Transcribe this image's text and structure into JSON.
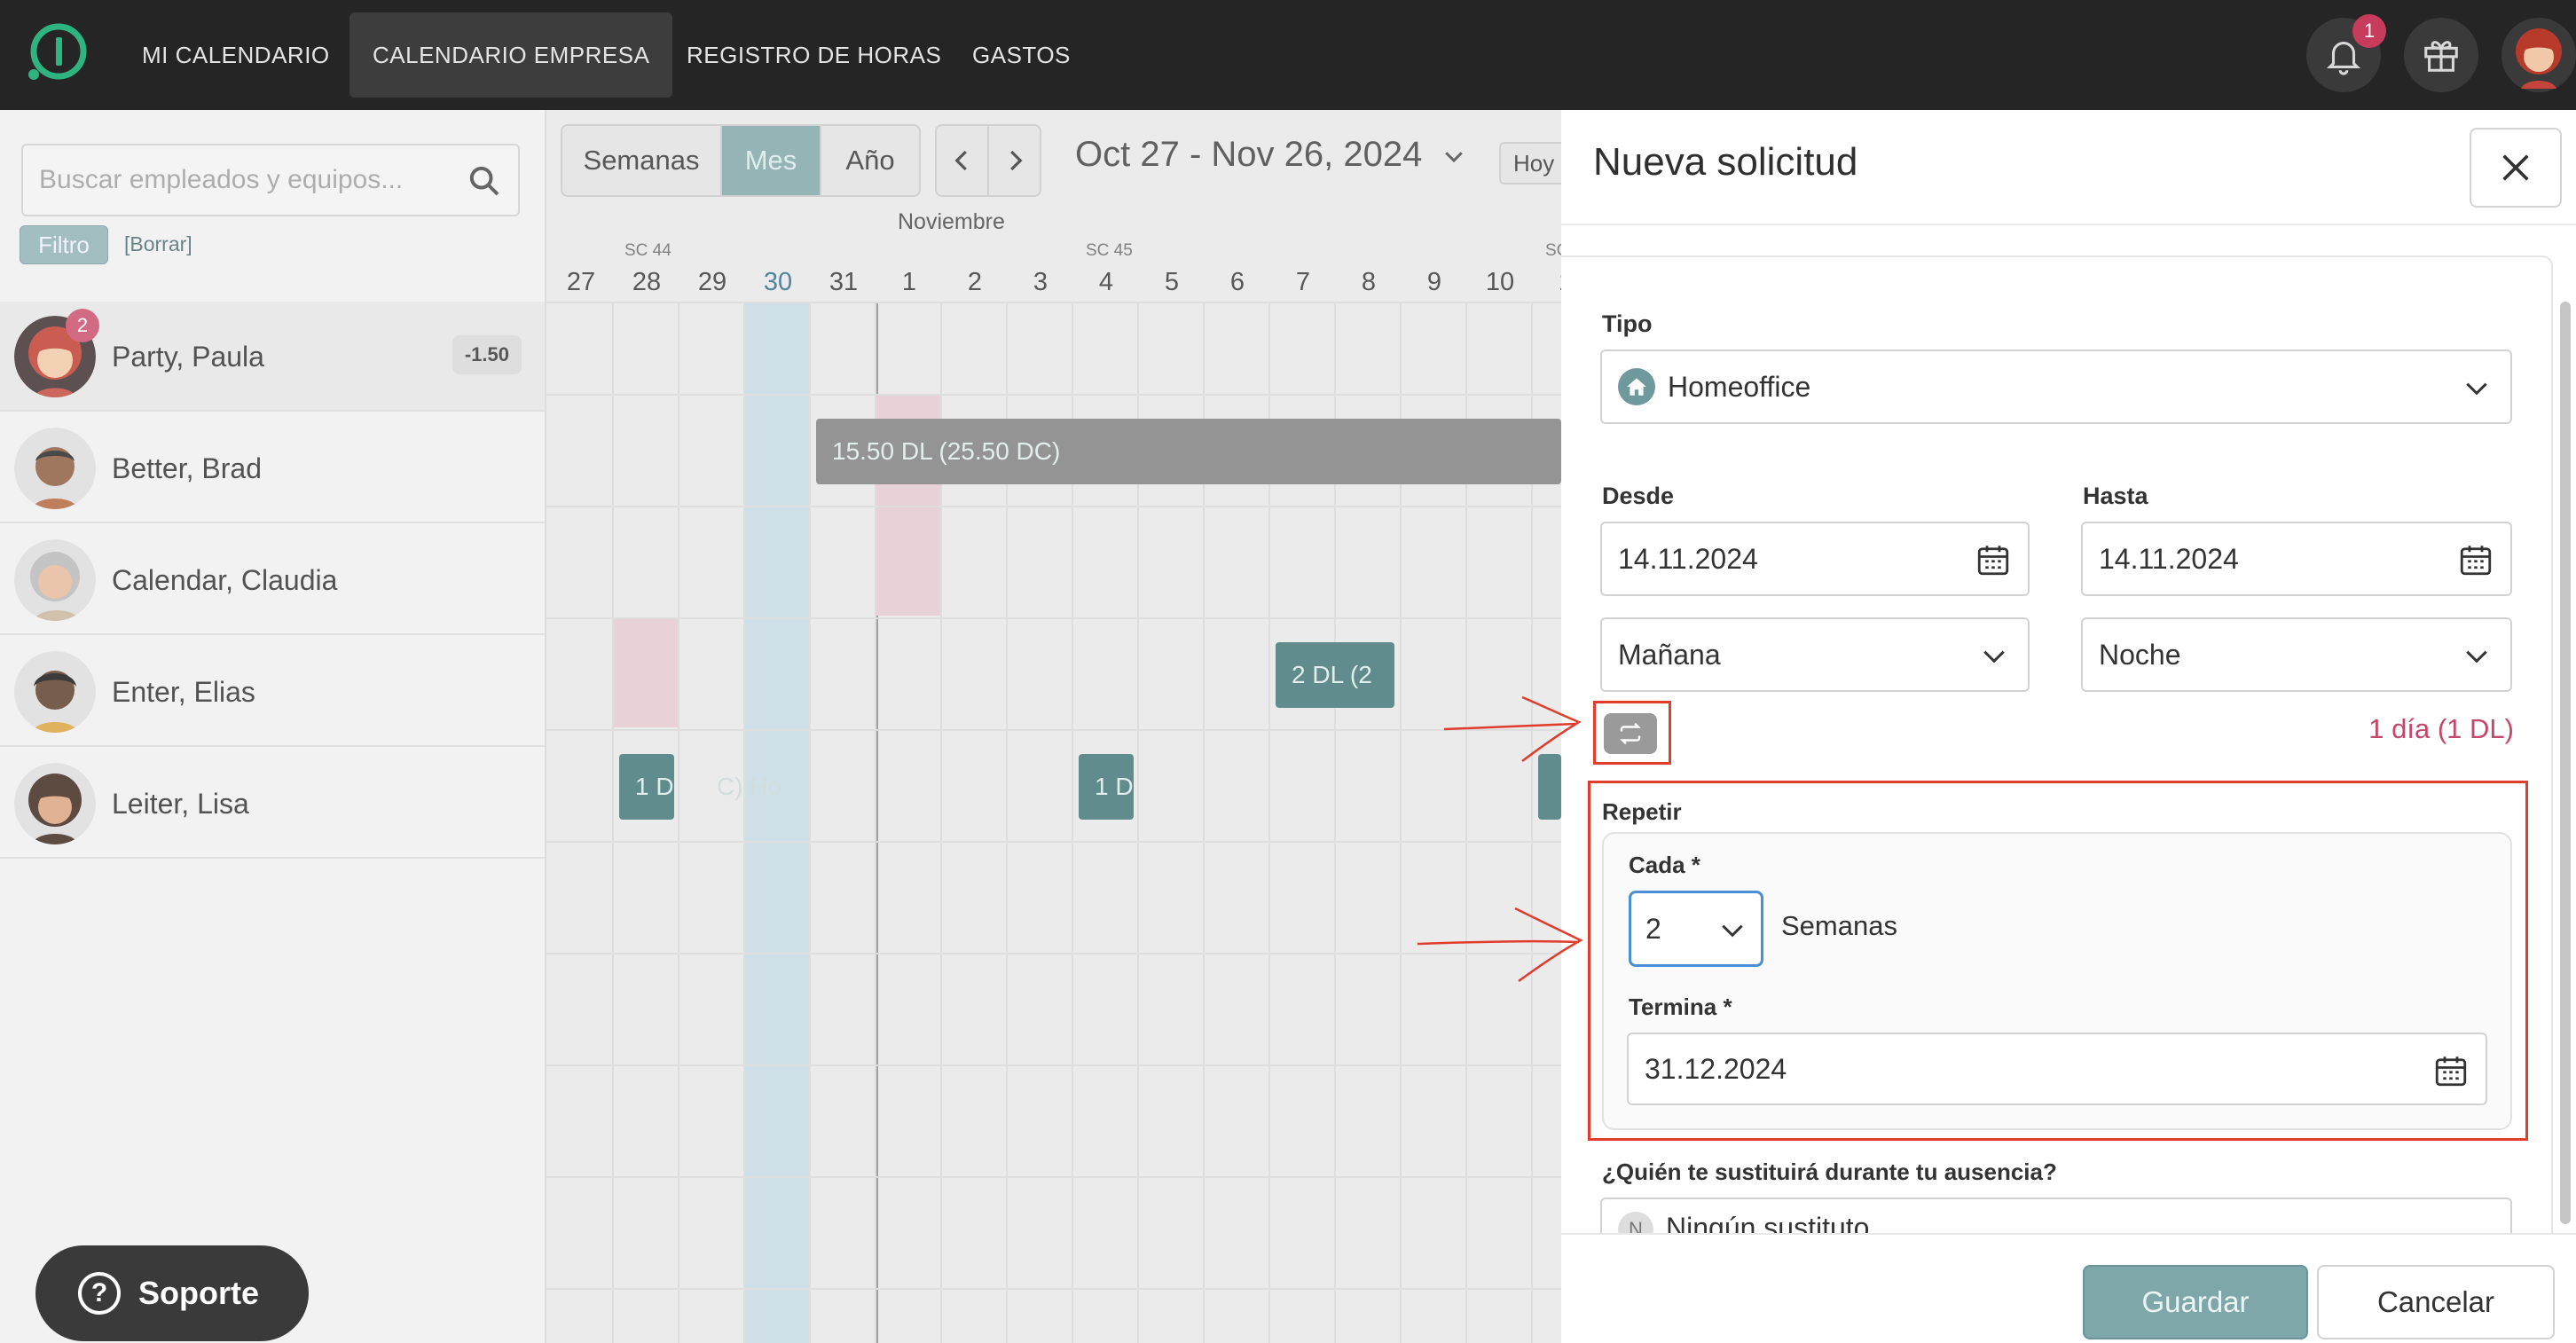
{
  "nav": {
    "items": [
      {
        "label": "MI CALENDARIO",
        "active": false
      },
      {
        "label": "CALENDARIO EMPRESA",
        "active": true
      },
      {
        "label": "REGISTRO DE HORAS",
        "active": false
      },
      {
        "label": "GASTOS",
        "active": false
      }
    ],
    "notification_count": "1"
  },
  "sidebar": {
    "search_placeholder": "Buscar empleados y equipos...",
    "filter_label": "Filtro",
    "clear_label": "[Borrar]",
    "employees": [
      {
        "name": "Party, Paula",
        "badge": "2",
        "value": "-1.50"
      },
      {
        "name": "Better, Brad"
      },
      {
        "name": "Calendar, Claudia"
      },
      {
        "name": "Enter, Elias"
      },
      {
        "name": "Leiter, Lisa"
      }
    ]
  },
  "support_label": "Soporte",
  "calendar": {
    "views": [
      "Semanas",
      "Mes",
      "Año"
    ],
    "active_view": "Mes",
    "range": "Oct 27 - Nov 26, 2024",
    "today_label": "Hoy",
    "month_label": "Noviembre",
    "week_labels": [
      {
        "label": "SC 44"
      },
      {
        "label": "SC 45"
      },
      {
        "label": "SC"
      }
    ],
    "days": [
      "27",
      "28",
      "29",
      "30",
      "31",
      "1",
      "2",
      "3",
      "4",
      "5",
      "6",
      "7",
      "8",
      "9",
      "10",
      "1"
    ],
    "events": [
      {
        "label": "15.50 DL (25.50 DC)"
      },
      {
        "label": "2 DL (2"
      },
      {
        "label": "1 D"
      },
      {
        "label": "C) Ho"
      },
      {
        "label": "1 D"
      }
    ]
  },
  "dialog": {
    "title": "Nueva solicitud",
    "tipo_label": "Tipo",
    "tipo_value": "Homeoffice",
    "desde_label": "Desde",
    "desde_value": "14.11.2024",
    "hasta_label": "Hasta",
    "hasta_value": "14.11.2024",
    "desde_time": "Mañana",
    "hasta_time": "Noche",
    "duration": "1 día (1 DL)",
    "repetir_label": "Repetir",
    "cada_label": "Cada *",
    "cada_value": "2",
    "cada_unit": "Semanas",
    "termina_label": "Termina *",
    "termina_value": "31.12.2024",
    "sustituto_label": "¿Quién te sustituirá durante tu ausencia?",
    "sustituto_initial": "N",
    "sustituto_value": "Ningún sustituto",
    "save_label": "Guardar",
    "cancel_label": "Cancelar"
  },
  "colors": {
    "accent": "#7da7a9",
    "highlight": "#e03d2c",
    "duration": "#c2476a"
  }
}
